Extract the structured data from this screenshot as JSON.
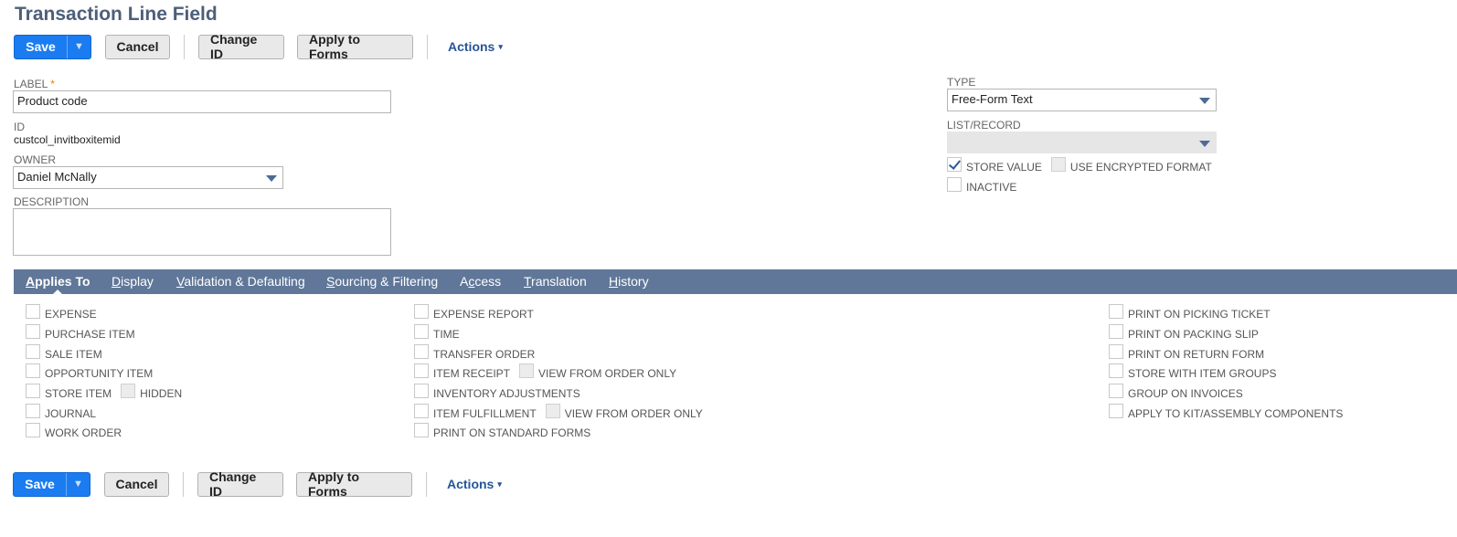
{
  "page": {
    "title": "Transaction Line Field"
  },
  "toolbar": {
    "save_label": "Save",
    "dropdown_glyph": "▼",
    "cancel_label": "Cancel",
    "change_id_label": "Change ID",
    "apply_to_forms_label": "Apply to Forms",
    "actions_label": "Actions",
    "actions_caret": "▾"
  },
  "form": {
    "label": {
      "caption": "LABEL",
      "required_mark": "*",
      "value": "Product code"
    },
    "id": {
      "caption": "ID",
      "value": "custcol_invitboxitemid"
    },
    "owner": {
      "caption": "OWNER",
      "value": "Daniel McNally"
    },
    "description": {
      "caption": "DESCRIPTION",
      "value": ""
    },
    "type": {
      "caption": "TYPE",
      "value": "Free-Form Text"
    },
    "list_record": {
      "caption": "LIST/RECORD",
      "value": ""
    },
    "store_value": {
      "label": "STORE VALUE",
      "checked": true
    },
    "use_encrypted": {
      "label": "USE ENCRYPTED FORMAT",
      "checked": false
    },
    "inactive": {
      "label": "INACTIVE",
      "checked": false
    }
  },
  "tabs": [
    {
      "key": "A",
      "rest": "pplies To",
      "active": true
    },
    {
      "key": "D",
      "rest": "isplay",
      "active": false
    },
    {
      "key": "V",
      "rest": "alidation & Defaulting",
      "active": false
    },
    {
      "key": "S",
      "rest": "ourcing & Filtering",
      "active": false
    },
    {
      "pre": "A",
      "key": "c",
      "rest": "cess",
      "active": false
    },
    {
      "key": "T",
      "rest": "ranslation",
      "active": false
    },
    {
      "key": "H",
      "rest": "istory",
      "active": false
    }
  ],
  "applies_to": {
    "col1": [
      "EXPENSE",
      "PURCHASE ITEM",
      "SALE ITEM",
      "OPPORTUNITY ITEM",
      "STORE ITEM",
      "JOURNAL",
      "WORK ORDER"
    ],
    "store_item_hidden": "HIDDEN",
    "col2": [
      "EXPENSE REPORT",
      "TIME",
      "TRANSFER ORDER",
      "ITEM RECEIPT",
      "INVENTORY ADJUSTMENTS",
      "ITEM FULFILLMENT",
      "PRINT ON STANDARD FORMS"
    ],
    "view_from_order_only": "VIEW FROM ORDER ONLY",
    "col3": [
      "PRINT ON PICKING TICKET",
      "PRINT ON PACKING SLIP",
      "PRINT ON RETURN FORM",
      "STORE WITH ITEM GROUPS",
      "GROUP ON INVOICES",
      "APPLY TO KIT/ASSEMBLY COMPONENTS"
    ]
  },
  "colors": {
    "primary": "#1a7cf0",
    "tabbar": "#607799",
    "title": "#4d5f79",
    "link": "#255599"
  }
}
